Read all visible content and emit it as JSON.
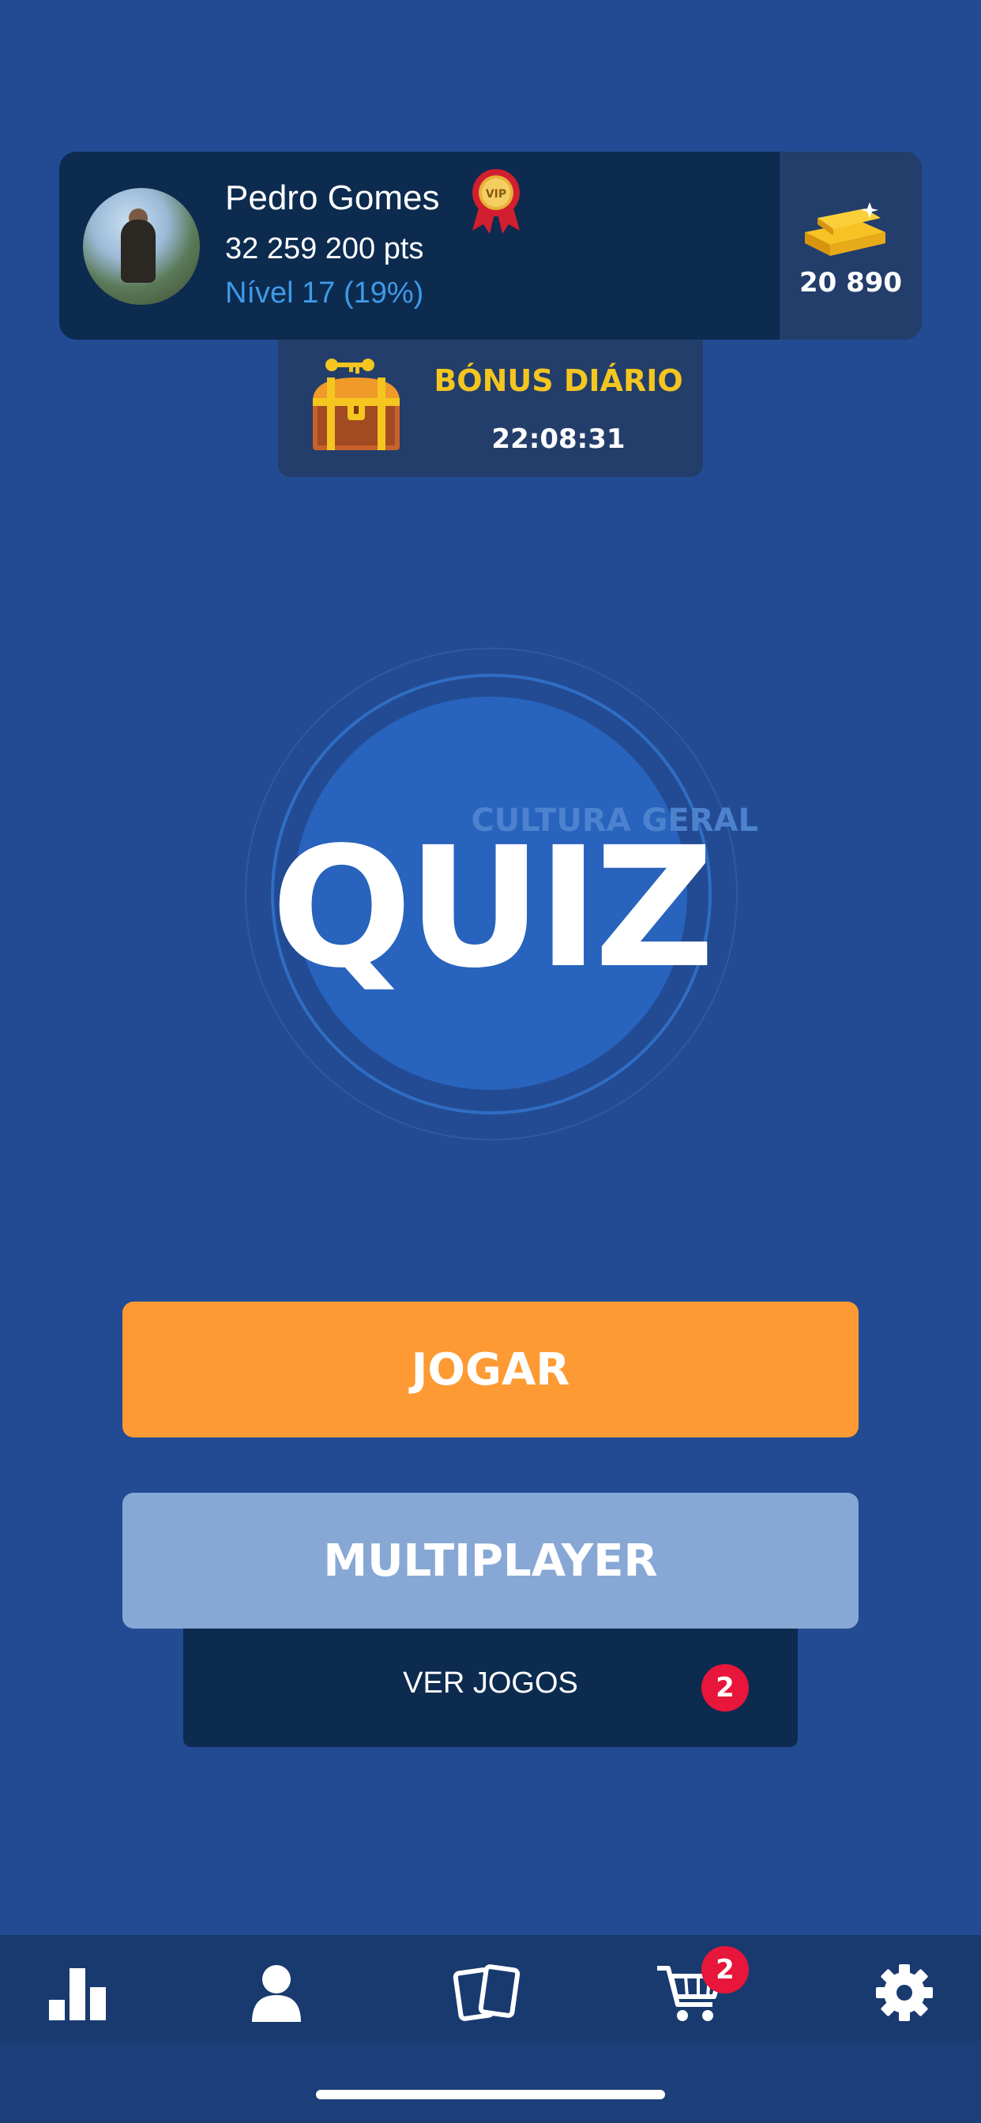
{
  "profile": {
    "name": "Pedro Gomes",
    "vip_label": "VIP",
    "points": "32 259 200 pts",
    "level": "Nível 17 (19%)",
    "coins": "20 890"
  },
  "bonus": {
    "title": "BÓNUS DIÁRIO",
    "timer": "22:08:31"
  },
  "logo": {
    "subtitle": "CULTURA GERAL",
    "title": "QUIZ"
  },
  "buttons": {
    "play": "JOGAR",
    "multiplayer": "MULTIPLAYER",
    "view_games": "VER JOGOS",
    "view_games_badge": "2"
  },
  "nav": {
    "items": [
      "ranking-icon",
      "profile-icon",
      "cards-icon",
      "cart-icon",
      "settings-icon"
    ],
    "cart_badge": "2"
  },
  "colors": {
    "background": "#234b93",
    "play_button": "#fd9a33",
    "multiplayer_button": "#87a8d5",
    "bonus_title": "#f5c520",
    "level_text": "#3e9ae8",
    "badge": "#e8163a"
  }
}
